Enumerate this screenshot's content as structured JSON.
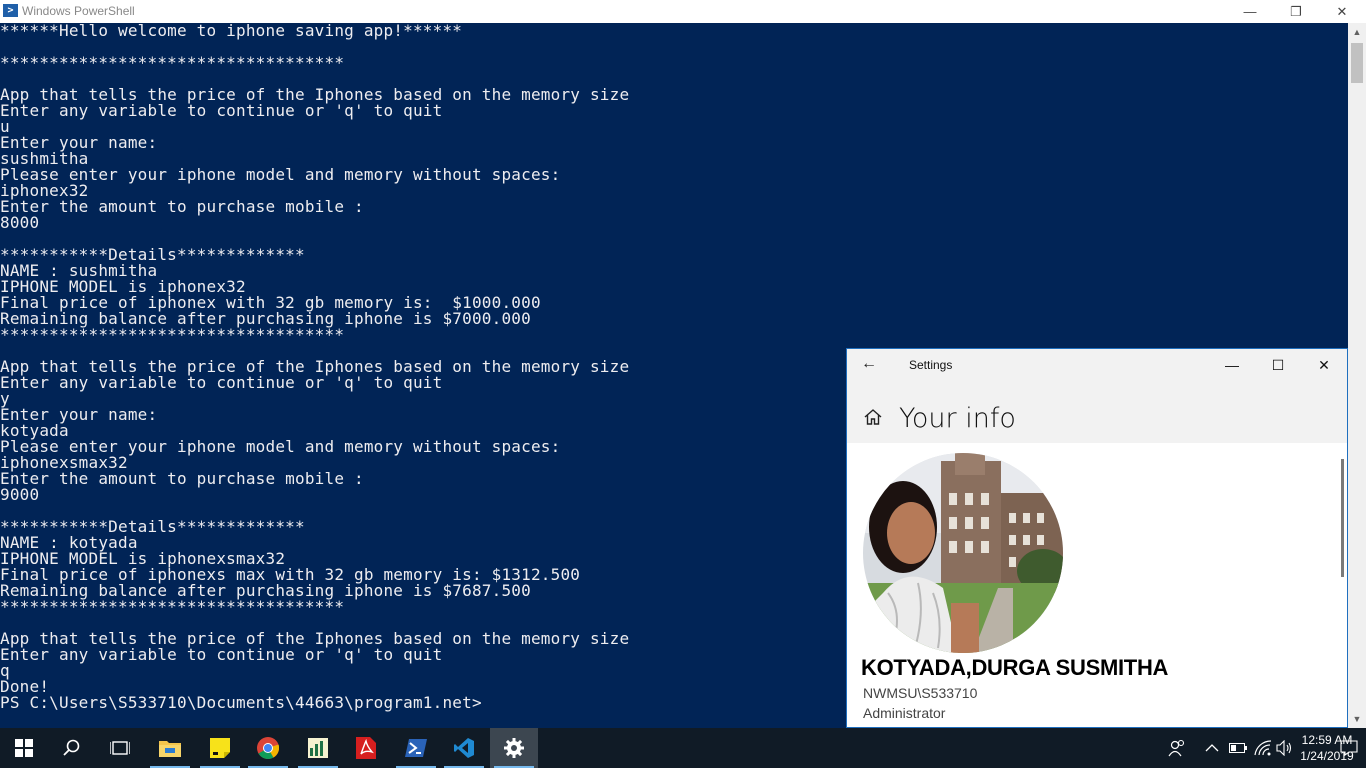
{
  "powershell": {
    "title": "Windows PowerShell",
    "controls": {
      "minimize": "—",
      "restore": "❐",
      "close": "✕"
    },
    "lines": [
      "******Hello welcome to iphone saving app!******",
      "",
      "***********************************",
      "",
      "App that tells the price of the Iphones based on the memory size",
      "Enter any variable to continue or 'q' to quit",
      "u",
      "Enter your name:",
      "sushmitha",
      "Please enter your iphone model and memory without spaces:",
      "iphonex32",
      "Enter the amount to purchase mobile :",
      "8000",
      "",
      "***********Details*************",
      "NAME : sushmitha",
      "IPHONE MODEL is iphonex32",
      "Final price of iphonex with 32 gb memory is:  $1000.000",
      "Remaining balance after purchasing iphone is $7000.000",
      "***********************************",
      "",
      "App that tells the price of the Iphones based on the memory size",
      "Enter any variable to continue or 'q' to quit",
      "y",
      "Enter your name:",
      "kotyada",
      "Please enter your iphone model and memory without spaces:",
      "iphonexsmax32",
      "Enter the amount to purchase mobile :",
      "9000",
      "",
      "***********Details*************",
      "NAME : kotyada",
      "IPHONE MODEL is iphonexsmax32",
      "Final price of iphonexs max with 32 gb memory is: $1312.500",
      "Remaining balance after purchasing iphone is $7687.500",
      "***********************************",
      "",
      "App that tells the price of the Iphones based on the memory size",
      "Enter any variable to continue or 'q' to quit",
      "q",
      "Done!",
      "PS C:\\Users\\S533710\\Documents\\44663\\program1.net>"
    ]
  },
  "settings": {
    "title": "Settings",
    "back_icon": "←",
    "controls": {
      "minimize": "—",
      "maximize": "☐",
      "close": "✕"
    },
    "heading": "Your info",
    "user_name": "KOTYADA,DURGA SUSMITHA",
    "account": "NWMSU\\S533710",
    "role": "Administrator"
  },
  "taskbar": {
    "time": "12:59 AM",
    "date": "1/24/2019",
    "apps": [
      "start-icon",
      "search-icon",
      "task-view-icon",
      "file-explorer-icon",
      "sticky-notes-icon",
      "chrome-icon",
      "excel-icon",
      "acrobat-icon",
      "powershell-icon",
      "vscode-icon",
      "settings-icon"
    ]
  },
  "colors": {
    "console_bg": "#012456",
    "console_fg": "#eeedf0",
    "taskbar_bg": "#101b26",
    "accent": "#76b9ed"
  }
}
